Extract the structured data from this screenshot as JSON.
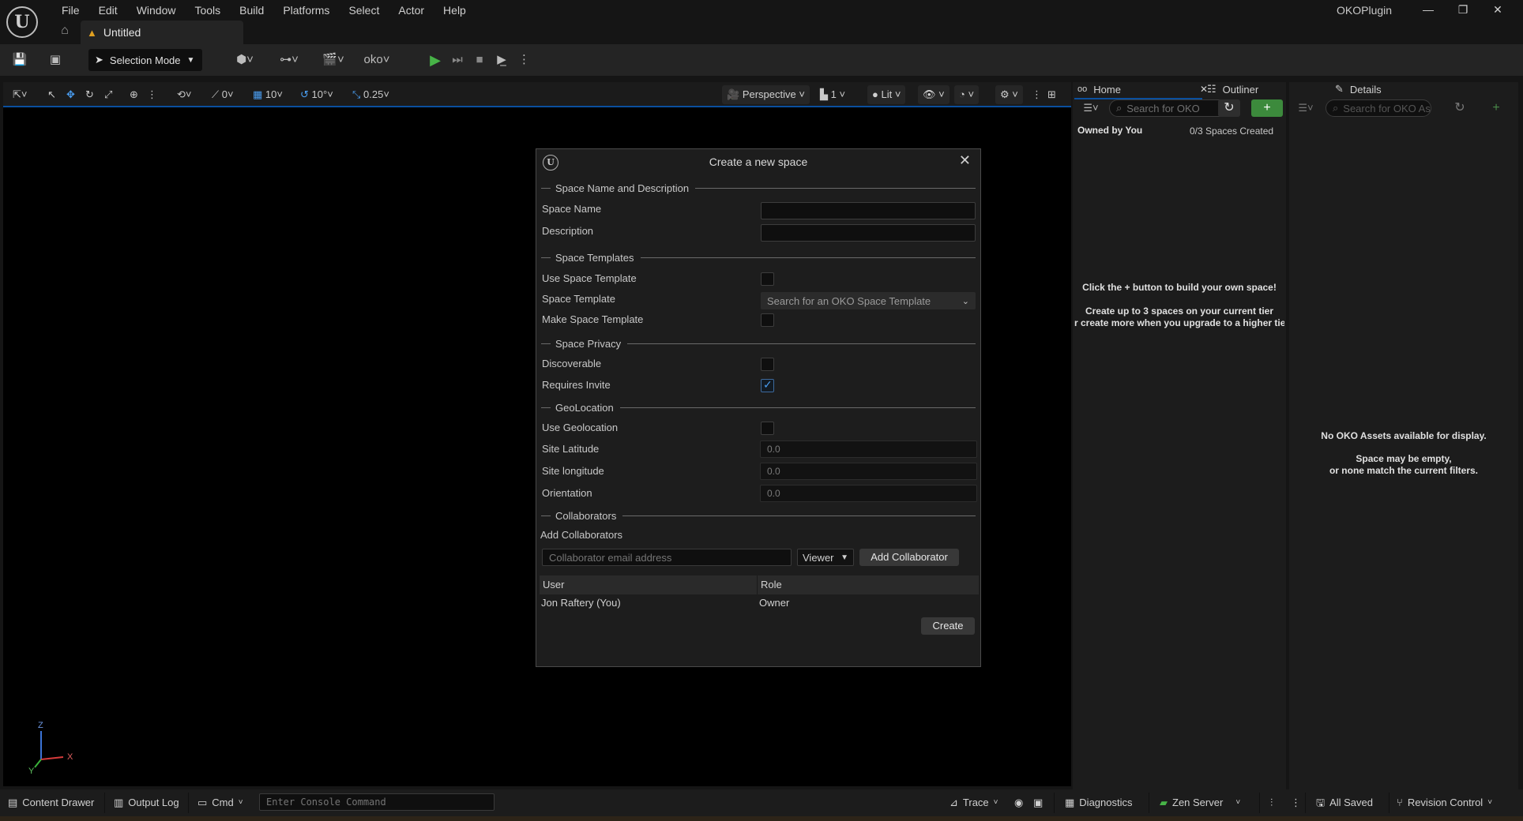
{
  "menu": [
    "File",
    "Edit",
    "Window",
    "Tools",
    "Build",
    "Platforms",
    "Select",
    "Actor",
    "Help"
  ],
  "doc_tab": "Untitled",
  "app_name": "OKOPlugin",
  "toolbar": {
    "selection_mode": "Selection Mode"
  },
  "viewport_toolbar": {
    "rotate_snap": "0",
    "grid_snap": "10",
    "angle_snap": "10°",
    "scale_snap": "0.25",
    "view_mode": "Perspective",
    "camera_count": "1",
    "lighting": "Lit"
  },
  "axes": {
    "z": "Z",
    "x": "X",
    "y": "Y"
  },
  "dialog": {
    "title": "Create a new space",
    "sections": {
      "name_desc": "Space Name and Description",
      "templates": "Space Templates",
      "privacy": "Space Privacy",
      "geo": "GeoLocation",
      "collaborators": "Collaborators"
    },
    "labels": {
      "space_name": "Space Name",
      "description": "Description",
      "use_template": "Use Space Template",
      "space_template": "Space Template",
      "make_template": "Make Space Template",
      "discoverable": "Discoverable",
      "requires_invite": "Requires Invite",
      "use_geo": "Use Geolocation",
      "site_lat": "Site Latitude",
      "site_lon": "Site longitude",
      "orientation": "Orientation",
      "add_collaborators": "Add Collaborators"
    },
    "values": {
      "space_name": "",
      "description": "",
      "template_placeholder": "Search for an OKO Space Template",
      "site_lat": "0.0",
      "site_lon": "0.0",
      "orientation": "0.0",
      "collab_email_placeholder": "Collaborator email address",
      "role": "Viewer"
    },
    "checks": {
      "use_template": false,
      "make_template": false,
      "discoverable": false,
      "requires_invite": true,
      "use_geo": false
    },
    "buttons": {
      "add_collaborator": "Add Collaborator",
      "create": "Create"
    },
    "table": {
      "headers": [
        "User",
        "Role"
      ],
      "rows": [
        [
          "Jon Raftery (You)",
          "Owner"
        ]
      ]
    }
  },
  "home_panel": {
    "tab": "Home",
    "search_placeholder": "Search for OKO",
    "owned_by": "Owned by You",
    "count": "0/3 Spaces Created",
    "msg1": "Click the + button to build your own space!",
    "msg2": "Create up to 3 spaces on your current tier",
    "msg3": "r create more when you upgrade to a higher tie"
  },
  "outliner_tab": "Outliner",
  "details_panel": {
    "tab": "Details",
    "search_placeholder": "Search for OKO As",
    "msg1": "No OKO Assets available for display.",
    "msg2": "Space may be empty,",
    "msg3": "or none match the current filters."
  },
  "statusbar": {
    "content_drawer": "Content Drawer",
    "output_log": "Output Log",
    "cmd": "Cmd",
    "console_placeholder": "Enter Console Command",
    "trace": "Trace",
    "diagnostics": "Diagnostics",
    "zen_server": "Zen Server",
    "all_saved": "All Saved",
    "revision_control": "Revision Control"
  },
  "colors": {
    "accent_blue": "#0a4f9e",
    "play_green": "#47b347",
    "add_green": "#3c8a3c",
    "warn": "#e0a020"
  }
}
